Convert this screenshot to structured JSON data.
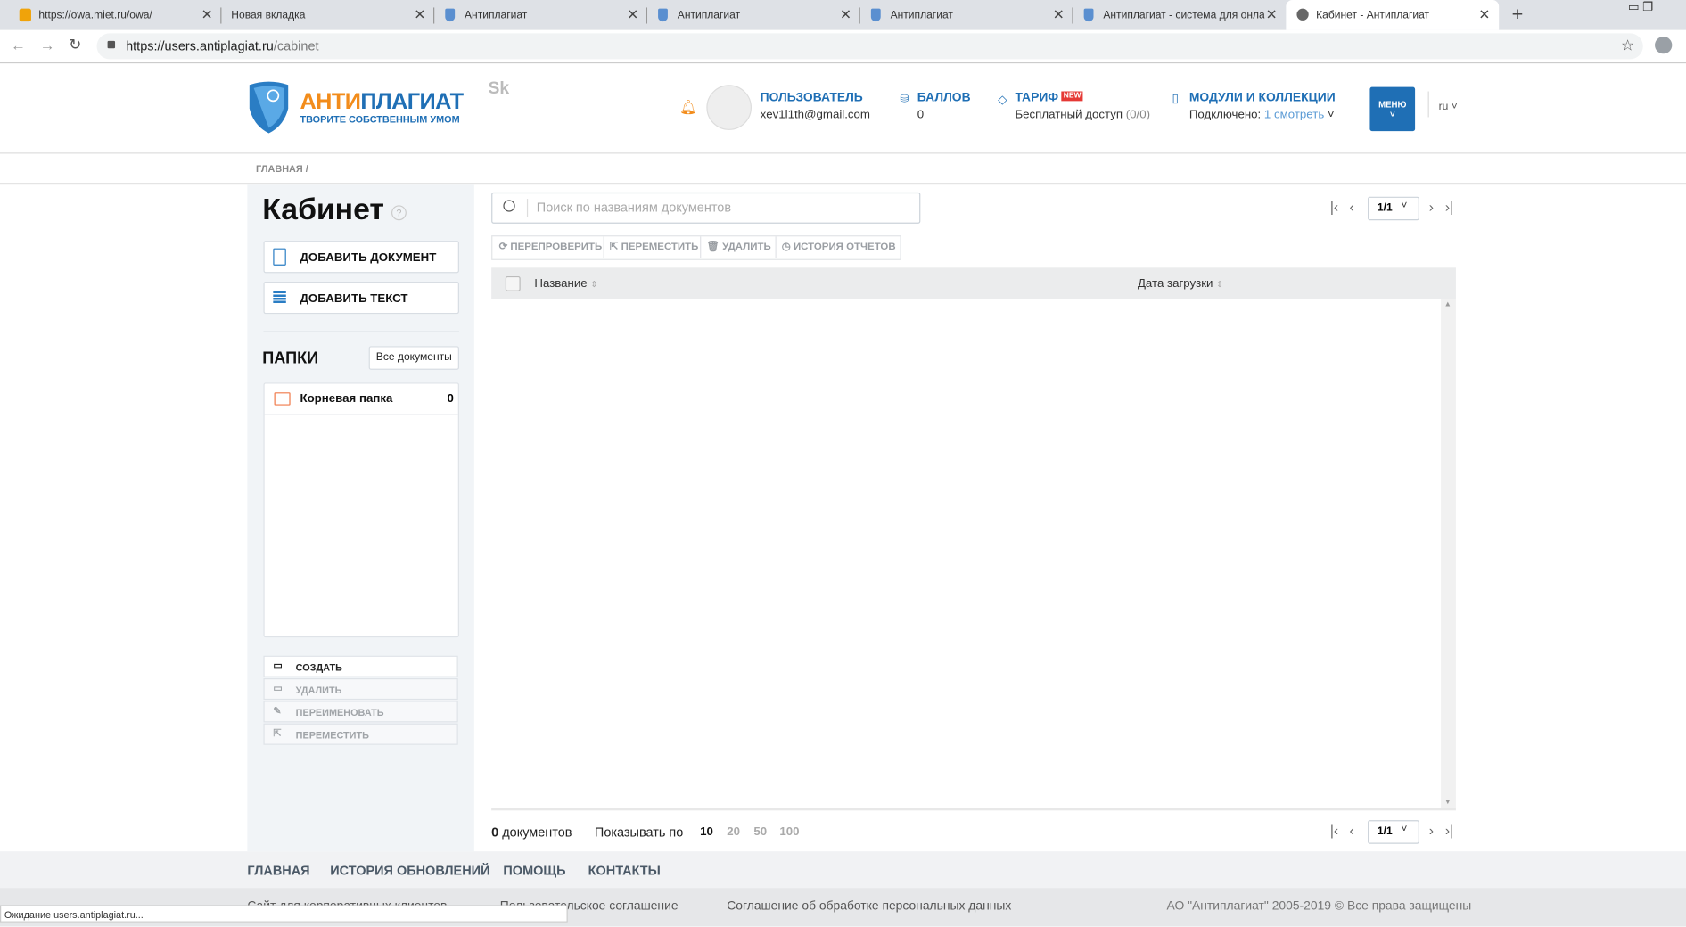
{
  "browser": {
    "tabs": [
      {
        "title": "https://owa.miet.ru/owa/",
        "icon": "outlook-icon"
      },
      {
        "title": "Новая вкладка",
        "icon": ""
      },
      {
        "title": "Антиплагиат",
        "icon": "shield-icon"
      },
      {
        "title": "Антиплагиат",
        "icon": "shield-icon"
      },
      {
        "title": "Антиплагиат",
        "icon": "shield-icon"
      },
      {
        "title": "Антиплагиат - система для онлайн",
        "icon": "shield-icon"
      },
      {
        "title": "Кабинет - Антиплагиат",
        "icon": "globe-icon",
        "active": true
      }
    ],
    "url_host": "https://users.antiplagiat.ru",
    "url_path": "/cabinet",
    "status": "Ожидание users.antiplagiat.ru..."
  },
  "header": {
    "logo_anti": "АНТИ",
    "logo_plagiat": "ПЛАГИАТ",
    "logo_slogan": "ТВОРИТЕ СОБСТВЕННЫМ УМОМ",
    "sk": "Sk",
    "user_label": "ПОЛЬЗОВАТЕЛЬ",
    "user_email": "xev1l1th@gmail.com",
    "points_label": "БАЛЛОВ",
    "points_value": "0",
    "tariff_label": "ТАРИФ",
    "tariff_badge": "NEW",
    "tariff_value": "Бесплатный доступ",
    "tariff_count": "(0/0)",
    "modules_label": "МОДУЛИ И КОЛЛЕКЦИИ",
    "modules_connected": "Подключено:",
    "modules_count": "1",
    "modules_link": "смотреть",
    "menu_label": "МЕНЮ",
    "lang": "ru",
    "accent": "#1f6fb5",
    "orange": "#f28c1b"
  },
  "breadcrumb": "ГЛАВНАЯ /",
  "sidebar": {
    "title": "Кабинет",
    "help": "?",
    "add_document": "ДОБАВИТЬ ДОКУМЕНТ",
    "add_text": "ДОБАВИТЬ ТЕКСТ",
    "folders_title": "ПАПКИ",
    "all_docs": "Все документы",
    "folders": [
      {
        "name": "Корневая папка",
        "count": "0"
      }
    ],
    "actions": [
      "СОЗДАТЬ",
      "УДАЛИТЬ",
      "ПЕРЕИМЕНОВАТЬ",
      "ПЕРЕМЕСТИТЬ"
    ]
  },
  "main": {
    "search_placeholder": "Поиск по названиям документов",
    "toolbar": [
      "ПЕРЕПРОВЕРИТЬ",
      "ПЕРЕМЕСТИТЬ",
      "УДАЛИТЬ",
      "ИСТОРИЯ ОТЧЕТОВ"
    ],
    "columns": [
      "Название",
      "Дата загрузки"
    ],
    "page": "1/1",
    "doc_count": "0",
    "doc_word": "документов",
    "per_page_label": "Показывать по",
    "per_page_options": [
      "10",
      "20",
      "50",
      "100"
    ],
    "per_page_selected": "10"
  },
  "footer": {
    "links": [
      "ГЛАВНАЯ",
      "ИСТОРИЯ ОБНОВЛЕНИЙ",
      "ПОМОЩЬ",
      "КОНТАКТЫ"
    ],
    "bottom": [
      "Сайт для корпоративных клиентов",
      "Пользовательское соглашение",
      "Соглашение об обработке персональных данных"
    ],
    "copyright": "АО \"Антиплагиат\" 2005-2019 © Все права защищены"
  }
}
